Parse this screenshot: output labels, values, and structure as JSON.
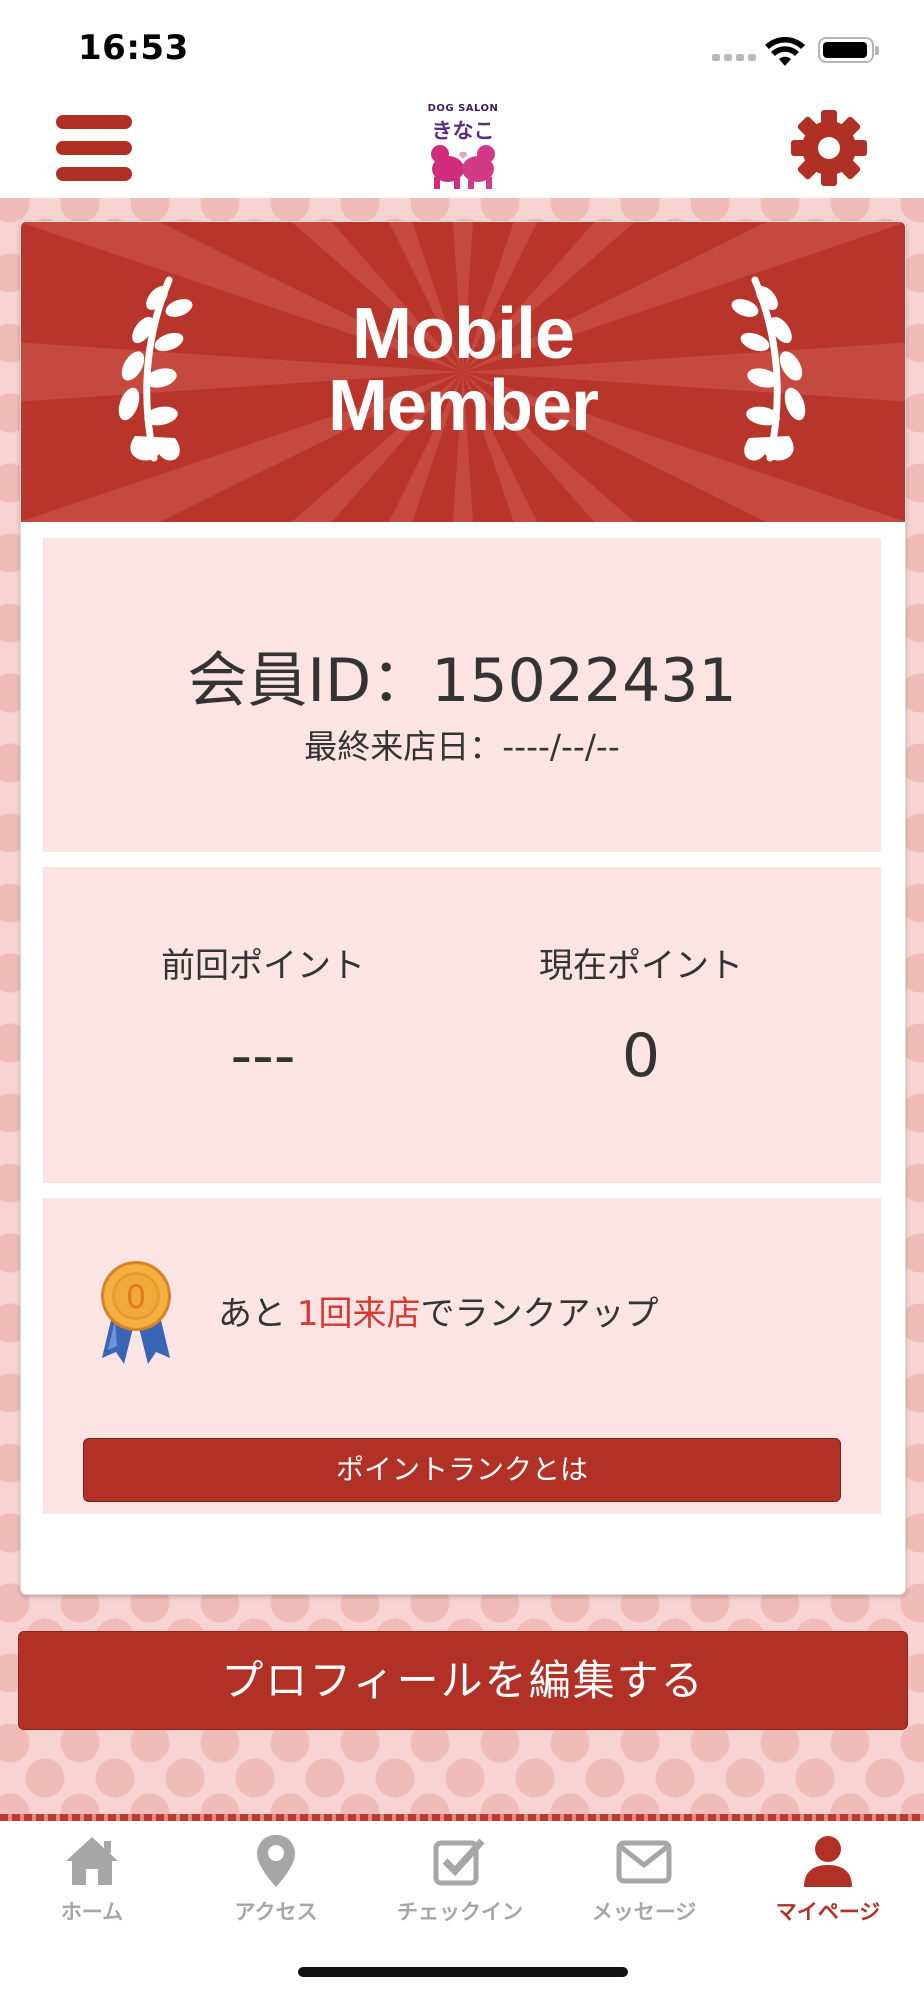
{
  "status_bar": {
    "time": "16:53"
  },
  "header": {
    "logo_small": "DOG SALON",
    "logo_main": "きなこ"
  },
  "banner": {
    "title_line1": "Mobile",
    "title_line2": "Member"
  },
  "member": {
    "id_text": "会員ID：15022431",
    "last_visit": "最終来店日：----/--/--"
  },
  "points": {
    "previous_label": "前回ポイント",
    "previous_value": "---",
    "current_label": "現在ポイント",
    "current_value": "0"
  },
  "rank": {
    "medal_number": "0",
    "text_prefix": "あと ",
    "text_highlight": "1回来店",
    "text_suffix": "でランクアップ",
    "button_label": "ポイントランクとは"
  },
  "profile_button": "プロフィールを編集する",
  "tabs": [
    {
      "label": "ホーム",
      "icon": "home-icon"
    },
    {
      "label": "アクセス",
      "icon": "map-pin-icon"
    },
    {
      "label": "チェックイン",
      "icon": "checkin-icon"
    },
    {
      "label": "メッセージ",
      "icon": "envelope-icon"
    },
    {
      "label": "マイページ",
      "icon": "person-icon",
      "active": true
    }
  ],
  "colors": {
    "accent": "#b23126",
    "panel": "#fbe4e3",
    "highlight": "#d63a2f",
    "tab_inactive": "#a6a6a6"
  }
}
